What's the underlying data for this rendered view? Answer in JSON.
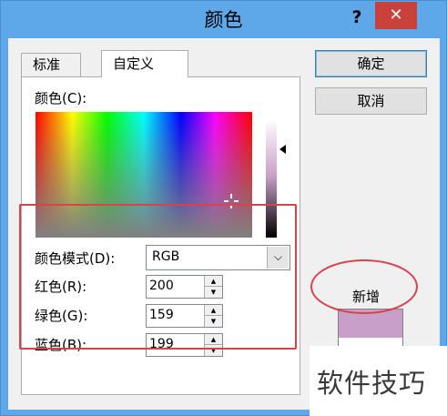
{
  "window": {
    "title": "颜色",
    "help_label": "?",
    "close_label": "✕"
  },
  "tabs": [
    {
      "label": "标准",
      "active": false
    },
    {
      "label": "自定义",
      "active": true
    }
  ],
  "custom": {
    "colors_label": "颜色(C):",
    "color_mode_label": "颜色模式(D):",
    "color_mode_value": "RGB",
    "red_label": "红色(R):",
    "red_value": "200",
    "green_label": "绿色(G):",
    "green_value": "159",
    "blue_label": "蓝色(B):",
    "blue_value": "199"
  },
  "buttons": {
    "ok_label": "确定",
    "cancel_label": "取消"
  },
  "preview": {
    "new_label": "新增",
    "new_color": "#c89fc7",
    "current_color": "#ffffff"
  },
  "colors": {
    "annotation": "#d8424a",
    "title_bar": "#5ea7e8",
    "close_button": "#c8413a"
  },
  "icons": {
    "dropdown": "chevron-down-icon",
    "spin_up": "triangle-up-icon",
    "spin_down": "triangle-down-icon",
    "luminance": "triangle-left-icon"
  },
  "watermark": "软件技巧"
}
